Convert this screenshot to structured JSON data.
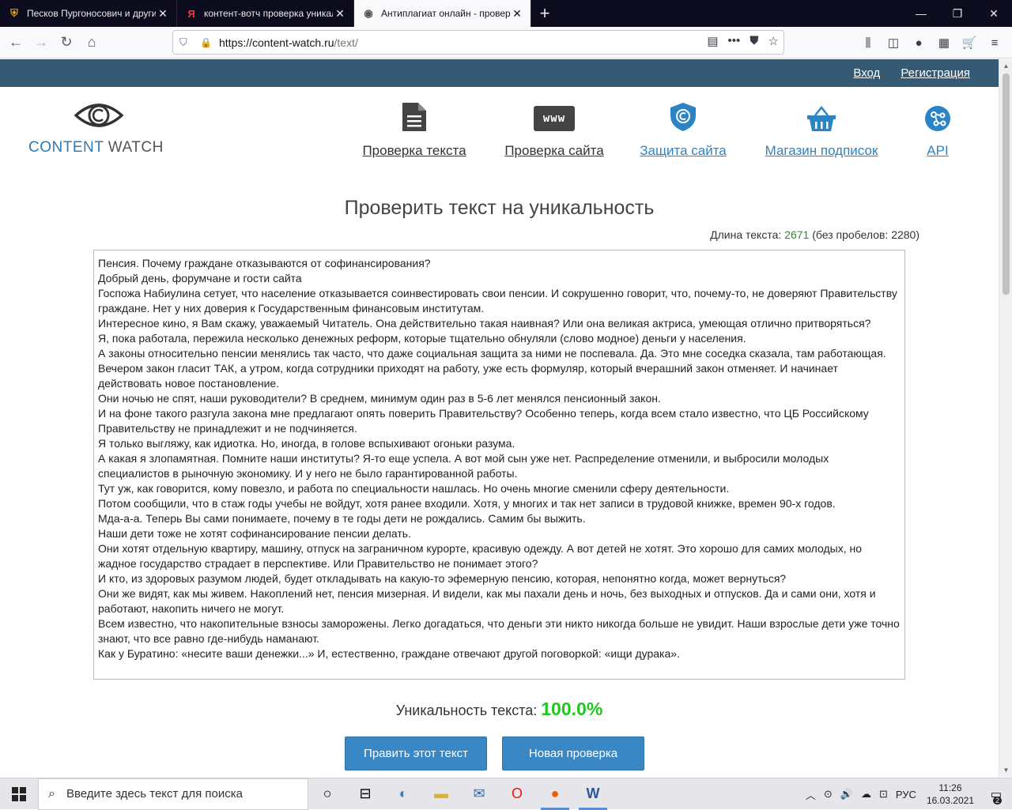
{
  "browser": {
    "tabs": [
      {
        "title": "Песков Пургоносович и другие",
        "favicon": "shield-favicon",
        "active": false
      },
      {
        "title": "контент-вотч проверка уникальности",
        "favicon": "yandex-favicon",
        "active": false
      },
      {
        "title": "Антиплагиат онлайн - проверка",
        "favicon": "eye-favicon",
        "active": true
      }
    ],
    "new_tab_glyph": "+",
    "url_host": "https://content-watch.ru",
    "url_path": "/text/"
  },
  "site": {
    "topbar": {
      "login": "Вход",
      "register": "Регистрация"
    },
    "logo": {
      "content": "CONTENT",
      "watch": "WATCH"
    },
    "nav": [
      {
        "label": "Проверка текста",
        "icon": "document-icon"
      },
      {
        "label": "Проверка сайта",
        "icon": "www-icon",
        "icon_text": "www"
      },
      {
        "label": "Защита сайта",
        "icon": "shield-copyright-icon"
      },
      {
        "label": "Магазин подписок",
        "icon": "basket-icon"
      },
      {
        "label": "API",
        "icon": "api-network-icon"
      }
    ],
    "title": "Проверить текст на уникальность",
    "length": {
      "prefix": "Длина текста: ",
      "value": "2671",
      "suffix": " (без пробелов: 2280)"
    },
    "text_lines": [
      "Пенсия. Почему граждане отказываются от софинансирования?",
      "Добрый день, форумчане и гости сайта",
      "Госпожа Набиулина сетует, что население отказывается соинвестировать свои пенсии. И сокрушенно говорит, что, почему-то, не доверяют Правительству граждане. Нет у них доверия к Государственным финансовым институтам.",
      "Интересное кино, я Вам скажу, уважаемый Читатель. Она действительно такая наивная? Или она великая актриса, умеющая отлично притворяться?",
      "Я, пока работала, пережила несколько денежных реформ, которые тщательно обнуляли (слово модное) деньги у населения.",
      "А законы относительно пенсии менялись так часто, что даже социальная защита за ними не поспевала. Да. Это мне соседка сказала, там работающая. Вечером закон гласит ТАК, а утром, когда сотрудники приходят на работу, уже есть формуляр, который вчерашний закон отменяет. И начинает действовать новое постановление.",
      "Они ночью не спят, наши руководители? В среднем, минимум один раз в 5-6 лет менялся пенсионный закон.",
      "И на фоне такого разгула закона мне предлагают опять поверить Правительству? Особенно теперь, когда всем стало известно, что ЦБ Российскому Правительству не принадлежит и не подчиняется.",
      "Я только выгляжу, как идиотка. Но, иногда, в голове вспыхивают огоньки разума.",
      "А какая я злопамятная. Помните наши институты? Я-то еще успела. А вот мой сын уже нет. Распределение отменили, и выбросили молодых специалистов в рыночную экономику. И у него не было гарантированной работы.",
      "Тут уж, как говорится, кому повезло, и работа по специальности нашлась. Но очень многие сменили сферу деятельности.",
      "Потом сообщили, что в стаж годы учебы не войдут, хотя ранее входили. Хотя, у многих и так нет записи в трудовой книжке, времен 90-х годов.",
      "Мда-а-а. Теперь Вы сами понимаете, почему в те годы дети не рождались. Самим бы выжить.",
      "Наши дети тоже не хотят софинансирование пенсии делать.",
      "Они хотят отдельную квартиру, машину, отпуск на заграничном курорте, красивую одежду. А вот детей не хотят. Это хорошо для самих молодых, но жадное государство страдает в перспективе. Или Правительство не понимает этого?",
      "И кто, из здоровых разумом людей, будет откладывать на какую-то эфемерную пенсию, которая, непонятно когда, может вернуться?",
      "Они же видят, как мы живем. Накоплений нет, пенсия мизерная. И видели, как мы пахали день и ночь, без выходных и отпусков. Да и сами они, хотя и работают, накопить ничего не могут.",
      "Всем известно, что накопительные взносы заморожены. Легко догадаться, что деньги эти никто никогда больше не увидит. Наши взрослые дети уже точно знают, что все равно где-нибудь наманают.",
      "Как у Буратино: «несите ваши денежки...» И, естественно, граждане отвечают другой поговоркой: «ищи дурака»."
    ],
    "uniqueness": {
      "label": "Уникальность текста: ",
      "value": "100.0%"
    },
    "buttons": {
      "edit": "Править этот текст",
      "new_check": "Новая проверка"
    },
    "colors": {
      "topbar": "#375a74",
      "accent": "#2b84c6",
      "button": "#3a87c5",
      "unique_green": "#1ec81e"
    }
  },
  "taskbar": {
    "search_placeholder": "Введите здесь текст для поиска",
    "lang": "РУС",
    "time": "11:26",
    "date": "16.03.2021",
    "notifications": "2"
  }
}
